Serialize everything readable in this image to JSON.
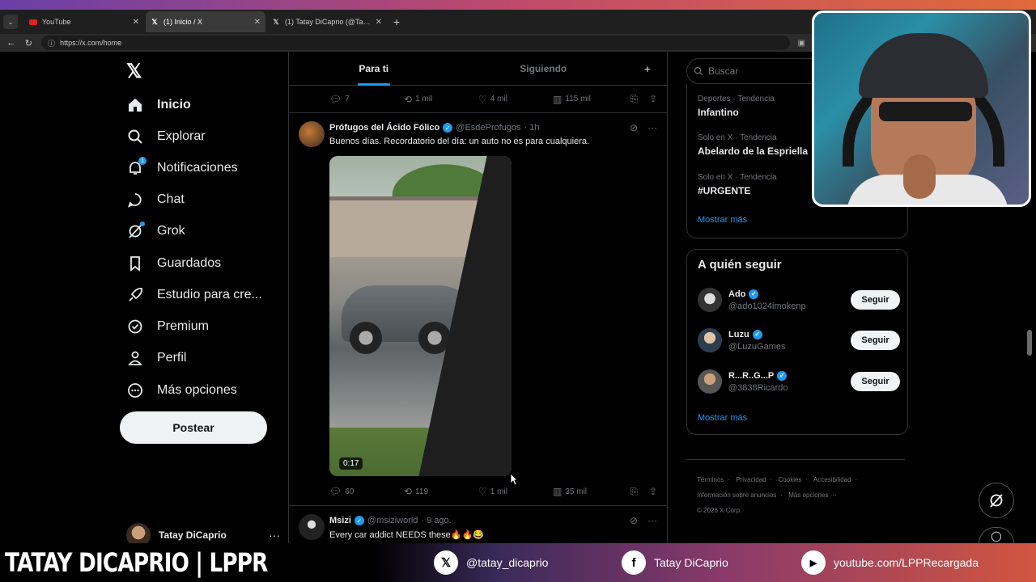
{
  "browser": {
    "tabs": [
      {
        "label": "YouTube",
        "icon": "youtube-icon"
      },
      {
        "label": "(1) Inicio / X",
        "icon": "x-logo-icon"
      },
      {
        "label": "(1) Tatay DiCaprio (@Tatay_DiCapr...",
        "icon": "x-logo-icon"
      }
    ],
    "url": "https://x.com/home"
  },
  "nav": {
    "items": [
      {
        "label": "Inicio",
        "icon": "home-icon"
      },
      {
        "label": "Explorar",
        "icon": "search-icon"
      },
      {
        "label": "Notificaciones",
        "icon": "bell-icon",
        "badge": "1"
      },
      {
        "label": "Chat",
        "icon": "chat-icon"
      },
      {
        "label": "Grok",
        "icon": "grok-icon"
      },
      {
        "label": "Guardados",
        "icon": "bookmark-icon"
      },
      {
        "label": "Estudio para cre...",
        "icon": "rocket-icon"
      },
      {
        "label": "Premium",
        "icon": "verified-icon"
      },
      {
        "label": "Perfil",
        "icon": "person-icon"
      },
      {
        "label": "Más opciones",
        "icon": "more-icon"
      }
    ],
    "post_label": "Postear",
    "account_name": "Tatay DiCaprio"
  },
  "feed": {
    "tabs": [
      "Para ti",
      "Siguiendo"
    ],
    "prev_actions": {
      "replies": "7",
      "reposts": "1 mil",
      "likes": "4 mil",
      "views": "115 mil"
    },
    "tweets": [
      {
        "name": "Prófugos del Ácido Fólico",
        "handle": "@EsdeProfugos",
        "time": "· 1h",
        "text": "Buenos días. Recordatorio del día: un auto no es para cualquiera.",
        "duration": "0:17",
        "replies": "60",
        "reposts": "119",
        "likes": "1 mil",
        "views": "35 mil"
      },
      {
        "name": "Msizi",
        "handle": "@msiziworld",
        "time": "· 9 ago.",
        "text": "Every car addict NEEDS these🔥🔥😂"
      }
    ]
  },
  "sidebar": {
    "search_placeholder": "Buscar",
    "trends": [
      {
        "meta": "Deportes · Tendencia",
        "topic": "Infantino"
      },
      {
        "meta": "Solo en X · Tendencia",
        "topic": "Abelardo de la Espriella"
      },
      {
        "meta": "Solo en X · Tendencia",
        "topic": "#URGENTE"
      }
    ],
    "show_more": "Mostrar más",
    "follow_title": "A quién seguir",
    "follow": [
      {
        "name": "Ado",
        "handle": "@ado1024imokenp"
      },
      {
        "name": "Luzu",
        "handle": "@LuzuGames"
      },
      {
        "name": "R...R..G...P",
        "handle": "@3838Ricardo"
      }
    ],
    "follow_label": "Seguir",
    "footer": [
      "Términos",
      "Privacidad",
      "Cookies",
      "Accesibilidad",
      "Información sobre anuncios",
      "Más opciones ···",
      "© 2026 X Corp."
    ]
  },
  "overlay": {
    "brand": "TATAY DICAPRIO | LPPR",
    "socials": [
      {
        "icon": "x-logo-icon",
        "label": "@tatay_dicaprio"
      },
      {
        "icon": "facebook-icon",
        "label": "Tatay DiCaprio"
      },
      {
        "icon": "youtube-icon",
        "label": "youtube.com/LPPRecargada"
      }
    ]
  },
  "colors": {
    "accent": "#1d9bf0",
    "background": "#000000",
    "text": "#e7e9ea",
    "muted": "#71767b"
  }
}
